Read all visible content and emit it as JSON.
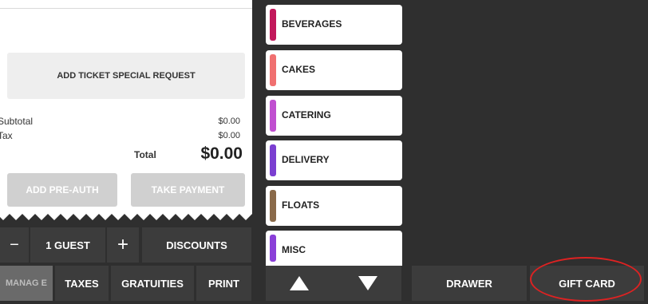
{
  "ticket": {
    "special_request": "ADD TICKET SPECIAL REQUEST",
    "subtotal_label": "Subtotal",
    "subtotal_value": "$0.00",
    "tax_label": "Tax",
    "tax_value": "$0.00",
    "total_label": "Total",
    "total_value": "$0.00",
    "preauth_label": "ADD PRE-AUTH",
    "payment_label": "TAKE PAYMENT"
  },
  "guest_bar": {
    "minus_label": "−",
    "guest_label": "1 GUEST",
    "plus_label": "+",
    "discounts_label": "DISCOUNTS"
  },
  "bottom_bar": {
    "manage_label": "MANAG E",
    "taxes_label": "TAXES",
    "gratuities_label": "GRATUITIES",
    "print_label": "PRINT"
  },
  "categories": [
    {
      "label": "BEVERAGES",
      "color": "#c2185b"
    },
    {
      "label": "CAKES",
      "color": "#f07070"
    },
    {
      "label": "CATERING",
      "color": "#c04fd0"
    },
    {
      "label": "DELIVERY",
      "color": "#7b3fd1"
    },
    {
      "label": "FLOATS",
      "color": "#8a6a4a"
    },
    {
      "label": "MISC",
      "color": "#8a3fd8"
    }
  ],
  "actions": {
    "drawer_label": "DRAWER",
    "gift_card_label": "GIFT CARD"
  }
}
